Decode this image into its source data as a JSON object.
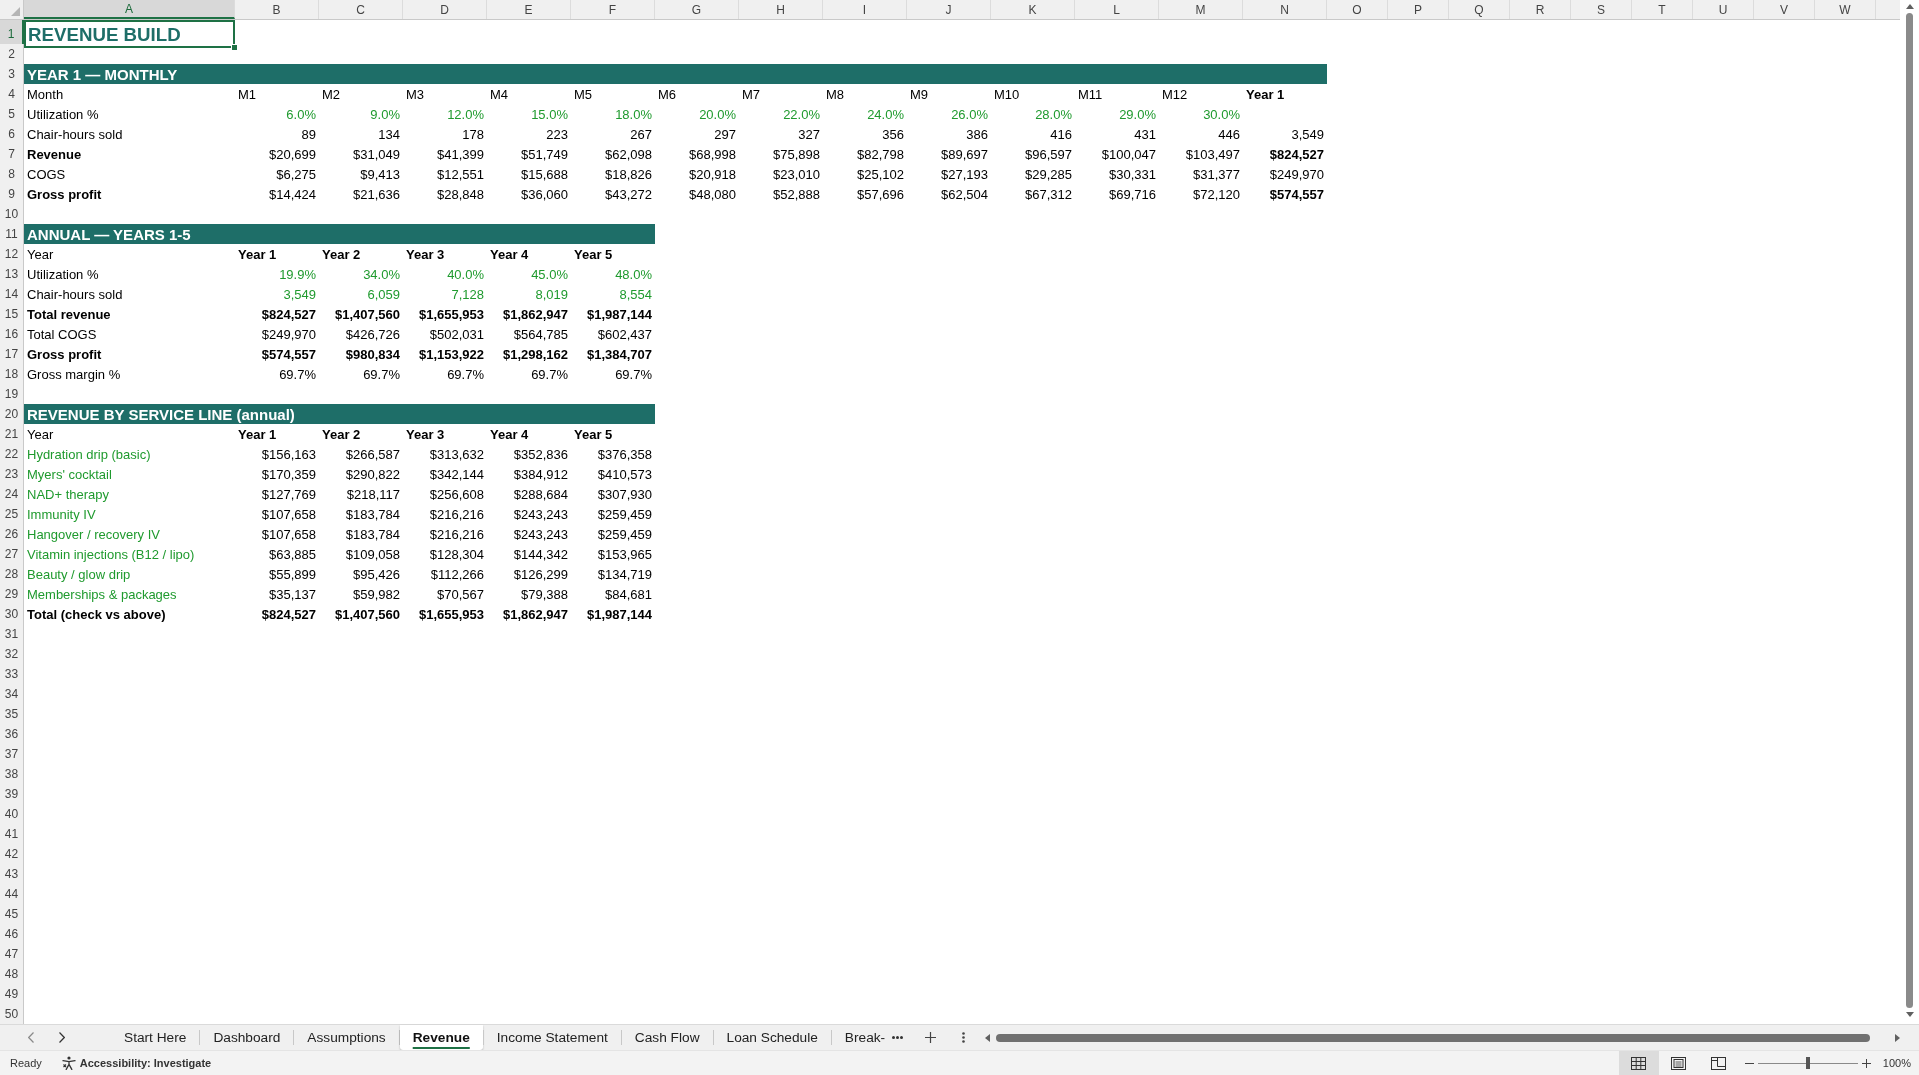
{
  "sheet": {
    "columns": [
      {
        "label": "A",
        "selected": true
      },
      {
        "label": "B",
        "selected": false
      },
      {
        "label": "C",
        "selected": false
      },
      {
        "label": "D",
        "selected": false
      },
      {
        "label": "E",
        "selected": false
      },
      {
        "label": "F",
        "selected": false
      },
      {
        "label": "G",
        "selected": false
      },
      {
        "label": "H",
        "selected": false
      },
      {
        "label": "I",
        "selected": false
      },
      {
        "label": "J",
        "selected": false
      },
      {
        "label": "K",
        "selected": false
      },
      {
        "label": "L",
        "selected": false
      },
      {
        "label": "M",
        "selected": false
      },
      {
        "label": "N",
        "selected": false
      },
      {
        "label": "O",
        "selected": false
      },
      {
        "label": "P",
        "selected": false
      },
      {
        "label": "Q",
        "selected": false
      },
      {
        "label": "R",
        "selected": false
      },
      {
        "label": "S",
        "selected": false
      },
      {
        "label": "T",
        "selected": false
      },
      {
        "label": "U",
        "selected": false
      },
      {
        "label": "V",
        "selected": false
      },
      {
        "label": "W",
        "selected": false
      }
    ],
    "rows": [
      {
        "label": "1",
        "selected": true
      },
      {
        "label": "2",
        "selected": false
      },
      {
        "label": "3",
        "selected": false
      },
      {
        "label": "4",
        "selected": false
      },
      {
        "label": "5",
        "selected": false
      },
      {
        "label": "6",
        "selected": false
      },
      {
        "label": "7",
        "selected": false
      },
      {
        "label": "8",
        "selected": false
      },
      {
        "label": "9",
        "selected": false
      },
      {
        "label": "10",
        "selected": false
      },
      {
        "label": "11",
        "selected": false
      },
      {
        "label": "12",
        "selected": false
      },
      {
        "label": "13",
        "selected": false
      },
      {
        "label": "14",
        "selected": false
      },
      {
        "label": "15",
        "selected": false
      },
      {
        "label": "16",
        "selected": false
      },
      {
        "label": "17",
        "selected": false
      },
      {
        "label": "18",
        "selected": false
      },
      {
        "label": "19",
        "selected": false
      },
      {
        "label": "20",
        "selected": false
      },
      {
        "label": "21",
        "selected": false
      },
      {
        "label": "22",
        "selected": false
      },
      {
        "label": "23",
        "selected": false
      },
      {
        "label": "24",
        "selected": false
      },
      {
        "label": "25",
        "selected": false
      },
      {
        "label": "26",
        "selected": false
      },
      {
        "label": "27",
        "selected": false
      },
      {
        "label": "28",
        "selected": false
      },
      {
        "label": "29",
        "selected": false
      },
      {
        "label": "30",
        "selected": false
      },
      {
        "label": "31",
        "selected": false
      },
      {
        "label": "32",
        "selected": false
      },
      {
        "label": "33",
        "selected": false
      },
      {
        "label": "34",
        "selected": false
      },
      {
        "label": "35",
        "selected": false
      },
      {
        "label": "36",
        "selected": false
      },
      {
        "label": "37",
        "selected": false
      },
      {
        "label": "38",
        "selected": false
      },
      {
        "label": "39",
        "selected": false
      },
      {
        "label": "40",
        "selected": false
      },
      {
        "label": "41",
        "selected": false
      },
      {
        "label": "42",
        "selected": false
      },
      {
        "label": "43",
        "selected": false
      },
      {
        "label": "44",
        "selected": false
      },
      {
        "label": "45",
        "selected": false
      },
      {
        "label": "46",
        "selected": false
      },
      {
        "label": "47",
        "selected": false
      },
      {
        "label": "48",
        "selected": false
      },
      {
        "label": "49",
        "selected": false
      },
      {
        "label": "50",
        "selected": false
      }
    ]
  },
  "title": {
    "text": "REVENUE BUILD",
    "selected": true
  },
  "monthly": {
    "heading": "YEAR 1 — MONTHLY",
    "rows": [
      {
        "kind": "header",
        "label": {
          "text": "Month",
          "bold": false,
          "color": "#000000"
        },
        "cells": [
          {
            "text": "M1",
            "bold": false,
            "color": "#000000"
          },
          {
            "text": "M2",
            "bold": false,
            "color": "#000000"
          },
          {
            "text": "M3",
            "bold": false,
            "color": "#000000"
          },
          {
            "text": "M4",
            "bold": false,
            "color": "#000000"
          },
          {
            "text": "M5",
            "bold": false,
            "color": "#000000"
          },
          {
            "text": "M6",
            "bold": false,
            "color": "#000000"
          },
          {
            "text": "M7",
            "bold": false,
            "color": "#000000"
          },
          {
            "text": "M8",
            "bold": false,
            "color": "#000000"
          },
          {
            "text": "M9",
            "bold": false,
            "color": "#000000"
          },
          {
            "text": "M10",
            "bold": false,
            "color": "#000000"
          },
          {
            "text": "M11",
            "bold": false,
            "color": "#000000"
          },
          {
            "text": "M12",
            "bold": false,
            "color": "#000000"
          },
          {
            "text": "Year 1",
            "bold": true,
            "color": "#000000"
          }
        ]
      },
      {
        "kind": "data",
        "label": {
          "text": "Utilization %",
          "bold": false,
          "color": "#000000"
        },
        "cells": [
          {
            "text": "6.0%",
            "bold": false,
            "color": "#1f9a2e"
          },
          {
            "text": "9.0%",
            "bold": false,
            "color": "#1f9a2e"
          },
          {
            "text": "12.0%",
            "bold": false,
            "color": "#1f9a2e"
          },
          {
            "text": "15.0%",
            "bold": false,
            "color": "#1f9a2e"
          },
          {
            "text": "18.0%",
            "bold": false,
            "color": "#1f9a2e"
          },
          {
            "text": "20.0%",
            "bold": false,
            "color": "#1f9a2e"
          },
          {
            "text": "22.0%",
            "bold": false,
            "color": "#1f9a2e"
          },
          {
            "text": "24.0%",
            "bold": false,
            "color": "#1f9a2e"
          },
          {
            "text": "26.0%",
            "bold": false,
            "color": "#1f9a2e"
          },
          {
            "text": "28.0%",
            "bold": false,
            "color": "#1f9a2e"
          },
          {
            "text": "29.0%",
            "bold": false,
            "color": "#1f9a2e"
          },
          {
            "text": "30.0%",
            "bold": false,
            "color": "#1f9a2e"
          }
        ]
      },
      {
        "kind": "data",
        "label": {
          "text": "Chair-hours sold",
          "bold": false,
          "color": "#000000"
        },
        "cells": [
          {
            "text": "89",
            "bold": false,
            "color": "#000000"
          },
          {
            "text": "134",
            "bold": false,
            "color": "#000000"
          },
          {
            "text": "178",
            "bold": false,
            "color": "#000000"
          },
          {
            "text": "223",
            "bold": false,
            "color": "#000000"
          },
          {
            "text": "267",
            "bold": false,
            "color": "#000000"
          },
          {
            "text": "297",
            "bold": false,
            "color": "#000000"
          },
          {
            "text": "327",
            "bold": false,
            "color": "#000000"
          },
          {
            "text": "356",
            "bold": false,
            "color": "#000000"
          },
          {
            "text": "386",
            "bold": false,
            "color": "#000000"
          },
          {
            "text": "416",
            "bold": false,
            "color": "#000000"
          },
          {
            "text": "431",
            "bold": false,
            "color": "#000000"
          },
          {
            "text": "446",
            "bold": false,
            "color": "#000000"
          },
          {
            "text": "3,549",
            "bold": false,
            "color": "#000000"
          }
        ]
      },
      {
        "kind": "data",
        "label": {
          "text": "Revenue",
          "bold": true,
          "color": "#000000"
        },
        "cells": [
          {
            "text": "$20,699",
            "bold": false,
            "color": "#000000"
          },
          {
            "text": "$31,049",
            "bold": false,
            "color": "#000000"
          },
          {
            "text": "$41,399",
            "bold": false,
            "color": "#000000"
          },
          {
            "text": "$51,749",
            "bold": false,
            "color": "#000000"
          },
          {
            "text": "$62,098",
            "bold": false,
            "color": "#000000"
          },
          {
            "text": "$68,998",
            "bold": false,
            "color": "#000000"
          },
          {
            "text": "$75,898",
            "bold": false,
            "color": "#000000"
          },
          {
            "text": "$82,798",
            "bold": false,
            "color": "#000000"
          },
          {
            "text": "$89,697",
            "bold": false,
            "color": "#000000"
          },
          {
            "text": "$96,597",
            "bold": false,
            "color": "#000000"
          },
          {
            "text": "$100,047",
            "bold": false,
            "color": "#000000"
          },
          {
            "text": "$103,497",
            "bold": false,
            "color": "#000000"
          },
          {
            "text": "$824,527",
            "bold": true,
            "color": "#000000"
          }
        ]
      },
      {
        "kind": "data",
        "label": {
          "text": "COGS",
          "bold": false,
          "color": "#000000"
        },
        "cells": [
          {
            "text": "$6,275",
            "bold": false,
            "color": "#000000"
          },
          {
            "text": "$9,413",
            "bold": false,
            "color": "#000000"
          },
          {
            "text": "$12,551",
            "bold": false,
            "color": "#000000"
          },
          {
            "text": "$15,688",
            "bold": false,
            "color": "#000000"
          },
          {
            "text": "$18,826",
            "bold": false,
            "color": "#000000"
          },
          {
            "text": "$20,918",
            "bold": false,
            "color": "#000000"
          },
          {
            "text": "$23,010",
            "bold": false,
            "color": "#000000"
          },
          {
            "text": "$25,102",
            "bold": false,
            "color": "#000000"
          },
          {
            "text": "$27,193",
            "bold": false,
            "color": "#000000"
          },
          {
            "text": "$29,285",
            "bold": false,
            "color": "#000000"
          },
          {
            "text": "$30,331",
            "bold": false,
            "color": "#000000"
          },
          {
            "text": "$31,377",
            "bold": false,
            "color": "#000000"
          },
          {
            "text": "$249,970",
            "bold": false,
            "color": "#000000"
          }
        ]
      },
      {
        "kind": "data",
        "label": {
          "text": "Gross profit",
          "bold": true,
          "color": "#000000"
        },
        "cells": [
          {
            "text": "$14,424",
            "bold": false,
            "color": "#000000"
          },
          {
            "text": "$21,636",
            "bold": false,
            "color": "#000000"
          },
          {
            "text": "$28,848",
            "bold": false,
            "color": "#000000"
          },
          {
            "text": "$36,060",
            "bold": false,
            "color": "#000000"
          },
          {
            "text": "$43,272",
            "bold": false,
            "color": "#000000"
          },
          {
            "text": "$48,080",
            "bold": false,
            "color": "#000000"
          },
          {
            "text": "$52,888",
            "bold": false,
            "color": "#000000"
          },
          {
            "text": "$57,696",
            "bold": false,
            "color": "#000000"
          },
          {
            "text": "$62,504",
            "bold": false,
            "color": "#000000"
          },
          {
            "text": "$67,312",
            "bold": false,
            "color": "#000000"
          },
          {
            "text": "$69,716",
            "bold": false,
            "color": "#000000"
          },
          {
            "text": "$72,120",
            "bold": false,
            "color": "#000000"
          },
          {
            "text": "$574,557",
            "bold": true,
            "color": "#000000"
          }
        ]
      }
    ]
  },
  "annual": {
    "heading": "ANNUAL — YEARS 1-5",
    "rows": [
      {
        "kind": "header",
        "label": {
          "text": "Year",
          "bold": false,
          "color": "#000000"
        },
        "cells": [
          {
            "text": "Year 1",
            "bold": true,
            "color": "#000000"
          },
          {
            "text": "Year 2",
            "bold": true,
            "color": "#000000"
          },
          {
            "text": "Year 3",
            "bold": true,
            "color": "#000000"
          },
          {
            "text": "Year 4",
            "bold": true,
            "color": "#000000"
          },
          {
            "text": "Year 5",
            "bold": true,
            "color": "#000000"
          }
        ]
      },
      {
        "kind": "data",
        "label": {
          "text": "Utilization %",
          "bold": false,
          "color": "#000000"
        },
        "cells": [
          {
            "text": "19.9%",
            "bold": false,
            "color": "#1f9a2e"
          },
          {
            "text": "34.0%",
            "bold": false,
            "color": "#1f9a2e"
          },
          {
            "text": "40.0%",
            "bold": false,
            "color": "#1f9a2e"
          },
          {
            "text": "45.0%",
            "bold": false,
            "color": "#1f9a2e"
          },
          {
            "text": "48.0%",
            "bold": false,
            "color": "#1f9a2e"
          }
        ]
      },
      {
        "kind": "data",
        "label": {
          "text": "Chair-hours sold",
          "bold": false,
          "color": "#000000"
        },
        "cells": [
          {
            "text": "3,549",
            "bold": false,
            "color": "#1f9a2e"
          },
          {
            "text": "6,059",
            "bold": false,
            "color": "#1f9a2e"
          },
          {
            "text": "7,128",
            "bold": false,
            "color": "#1f9a2e"
          },
          {
            "text": "8,019",
            "bold": false,
            "color": "#1f9a2e"
          },
          {
            "text": "8,554",
            "bold": false,
            "color": "#1f9a2e"
          }
        ]
      },
      {
        "kind": "data",
        "label": {
          "text": "Total revenue",
          "bold": true,
          "color": "#000000"
        },
        "cells": [
          {
            "text": "$824,527",
            "bold": true,
            "color": "#000000"
          },
          {
            "text": "$1,407,560",
            "bold": true,
            "color": "#000000"
          },
          {
            "text": "$1,655,953",
            "bold": true,
            "color": "#000000"
          },
          {
            "text": "$1,862,947",
            "bold": true,
            "color": "#000000"
          },
          {
            "text": "$1,987,144",
            "bold": true,
            "color": "#000000"
          }
        ]
      },
      {
        "kind": "data",
        "label": {
          "text": "Total COGS",
          "bold": false,
          "color": "#000000"
        },
        "cells": [
          {
            "text": "$249,970",
            "bold": false,
            "color": "#000000"
          },
          {
            "text": "$426,726",
            "bold": false,
            "color": "#000000"
          },
          {
            "text": "$502,031",
            "bold": false,
            "color": "#000000"
          },
          {
            "text": "$564,785",
            "bold": false,
            "color": "#000000"
          },
          {
            "text": "$602,437",
            "bold": false,
            "color": "#000000"
          }
        ]
      },
      {
        "kind": "data",
        "label": {
          "text": "Gross profit",
          "bold": true,
          "color": "#000000"
        },
        "cells": [
          {
            "text": "$574,557",
            "bold": true,
            "color": "#000000"
          },
          {
            "text": "$980,834",
            "bold": true,
            "color": "#000000"
          },
          {
            "text": "$1,153,922",
            "bold": true,
            "color": "#000000"
          },
          {
            "text": "$1,298,162",
            "bold": true,
            "color": "#000000"
          },
          {
            "text": "$1,384,707",
            "bold": true,
            "color": "#000000"
          }
        ]
      },
      {
        "kind": "data",
        "label": {
          "text": "Gross margin %",
          "bold": false,
          "color": "#000000"
        },
        "cells": [
          {
            "text": "69.7%",
            "bold": false,
            "color": "#000000"
          },
          {
            "text": "69.7%",
            "bold": false,
            "color": "#000000"
          },
          {
            "text": "69.7%",
            "bold": false,
            "color": "#000000"
          },
          {
            "text": "69.7%",
            "bold": false,
            "color": "#000000"
          },
          {
            "text": "69.7%",
            "bold": false,
            "color": "#000000"
          }
        ]
      }
    ]
  },
  "service_lines": {
    "heading": "REVENUE BY SERVICE LINE (annual)",
    "rows": [
      {
        "kind": "header",
        "label": {
          "text": "Year",
          "bold": false,
          "color": "#000000"
        },
        "cells": [
          {
            "text": "Year 1",
            "bold": true,
            "color": "#000000"
          },
          {
            "text": "Year 2",
            "bold": true,
            "color": "#000000"
          },
          {
            "text": "Year 3",
            "bold": true,
            "color": "#000000"
          },
          {
            "text": "Year 4",
            "bold": true,
            "color": "#000000"
          },
          {
            "text": "Year 5",
            "bold": true,
            "color": "#000000"
          }
        ]
      },
      {
        "kind": "data",
        "label": {
          "text": "Hydration drip (basic)",
          "bold": false,
          "color": "#1f9a2e"
        },
        "cells": [
          {
            "text": "$156,163",
            "bold": false,
            "color": "#000000"
          },
          {
            "text": "$266,587",
            "bold": false,
            "color": "#000000"
          },
          {
            "text": "$313,632",
            "bold": false,
            "color": "#000000"
          },
          {
            "text": "$352,836",
            "bold": false,
            "color": "#000000"
          },
          {
            "text": "$376,358",
            "bold": false,
            "color": "#000000"
          }
        ]
      },
      {
        "kind": "data",
        "label": {
          "text": "Myers' cocktail",
          "bold": false,
          "color": "#1f9a2e"
        },
        "cells": [
          {
            "text": "$170,359",
            "bold": false,
            "color": "#000000"
          },
          {
            "text": "$290,822",
            "bold": false,
            "color": "#000000"
          },
          {
            "text": "$342,144",
            "bold": false,
            "color": "#000000"
          },
          {
            "text": "$384,912",
            "bold": false,
            "color": "#000000"
          },
          {
            "text": "$410,573",
            "bold": false,
            "color": "#000000"
          }
        ]
      },
      {
        "kind": "data",
        "label": {
          "text": "NAD+ therapy",
          "bold": false,
          "color": "#1f9a2e"
        },
        "cells": [
          {
            "text": "$127,769",
            "bold": false,
            "color": "#000000"
          },
          {
            "text": "$218,117",
            "bold": false,
            "color": "#000000"
          },
          {
            "text": "$256,608",
            "bold": false,
            "color": "#000000"
          },
          {
            "text": "$288,684",
            "bold": false,
            "color": "#000000"
          },
          {
            "text": "$307,930",
            "bold": false,
            "color": "#000000"
          }
        ]
      },
      {
        "kind": "data",
        "label": {
          "text": "Immunity IV",
          "bold": false,
          "color": "#1f9a2e"
        },
        "cells": [
          {
            "text": "$107,658",
            "bold": false,
            "color": "#000000"
          },
          {
            "text": "$183,784",
            "bold": false,
            "color": "#000000"
          },
          {
            "text": "$216,216",
            "bold": false,
            "color": "#000000"
          },
          {
            "text": "$243,243",
            "bold": false,
            "color": "#000000"
          },
          {
            "text": "$259,459",
            "bold": false,
            "color": "#000000"
          }
        ]
      },
      {
        "kind": "data",
        "label": {
          "text": "Hangover / recovery IV",
          "bold": false,
          "color": "#1f9a2e"
        },
        "cells": [
          {
            "text": "$107,658",
            "bold": false,
            "color": "#000000"
          },
          {
            "text": "$183,784",
            "bold": false,
            "color": "#000000"
          },
          {
            "text": "$216,216",
            "bold": false,
            "color": "#000000"
          },
          {
            "text": "$243,243",
            "bold": false,
            "color": "#000000"
          },
          {
            "text": "$259,459",
            "bold": false,
            "color": "#000000"
          }
        ]
      },
      {
        "kind": "data",
        "label": {
          "text": "Vitamin injections (B12 / lipo)",
          "bold": false,
          "color": "#1f9a2e"
        },
        "cells": [
          {
            "text": "$63,885",
            "bold": false,
            "color": "#000000"
          },
          {
            "text": "$109,058",
            "bold": false,
            "color": "#000000"
          },
          {
            "text": "$128,304",
            "bold": false,
            "color": "#000000"
          },
          {
            "text": "$144,342",
            "bold": false,
            "color": "#000000"
          },
          {
            "text": "$153,965",
            "bold": false,
            "color": "#000000"
          }
        ]
      },
      {
        "kind": "data",
        "label": {
          "text": "Beauty / glow drip",
          "bold": false,
          "color": "#1f9a2e"
        },
        "cells": [
          {
            "text": "$55,899",
            "bold": false,
            "color": "#000000"
          },
          {
            "text": "$95,426",
            "bold": false,
            "color": "#000000"
          },
          {
            "text": "$112,266",
            "bold": false,
            "color": "#000000"
          },
          {
            "text": "$126,299",
            "bold": false,
            "color": "#000000"
          },
          {
            "text": "$134,719",
            "bold": false,
            "color": "#000000"
          }
        ]
      },
      {
        "kind": "data",
        "label": {
          "text": "Memberships & packages",
          "bold": false,
          "color": "#1f9a2e"
        },
        "cells": [
          {
            "text": "$35,137",
            "bold": false,
            "color": "#000000"
          },
          {
            "text": "$59,982",
            "bold": false,
            "color": "#000000"
          },
          {
            "text": "$70,567",
            "bold": false,
            "color": "#000000"
          },
          {
            "text": "$79,388",
            "bold": false,
            "color": "#000000"
          },
          {
            "text": "$84,681",
            "bold": false,
            "color": "#000000"
          }
        ]
      },
      {
        "kind": "data",
        "label": {
          "text": "Total (check vs above)",
          "bold": true,
          "color": "#000000"
        },
        "cells": [
          {
            "text": "$824,527",
            "bold": true,
            "color": "#000000"
          },
          {
            "text": "$1,407,560",
            "bold": true,
            "color": "#000000"
          },
          {
            "text": "$1,655,953",
            "bold": true,
            "color": "#000000"
          },
          {
            "text": "$1,862,947",
            "bold": true,
            "color": "#000000"
          },
          {
            "text": "$1,987,144",
            "bold": true,
            "color": "#000000"
          }
        ]
      }
    ]
  },
  "sheet_tabs": [
    {
      "label": "Start Here",
      "selected": false
    },
    {
      "label": "Dashboard",
      "selected": false
    },
    {
      "label": "Assumptions",
      "selected": false
    },
    {
      "label": "Revenue",
      "selected": true
    },
    {
      "label": "Income Statement",
      "selected": false
    },
    {
      "label": "Cash Flow",
      "selected": false
    },
    {
      "label": "Loan Schedule",
      "selected": false
    },
    {
      "label": "Break-",
      "selected": false
    }
  ],
  "status_bar": {
    "status": "Ready",
    "accessibility": "Accessibility: Investigate",
    "views": [
      {
        "kind": "normal",
        "selected": true
      },
      {
        "kind": "page_layout",
        "selected": false
      },
      {
        "kind": "page_break",
        "selected": false
      }
    ],
    "zoom": {
      "level": 0.5,
      "reading": "100%"
    }
  }
}
